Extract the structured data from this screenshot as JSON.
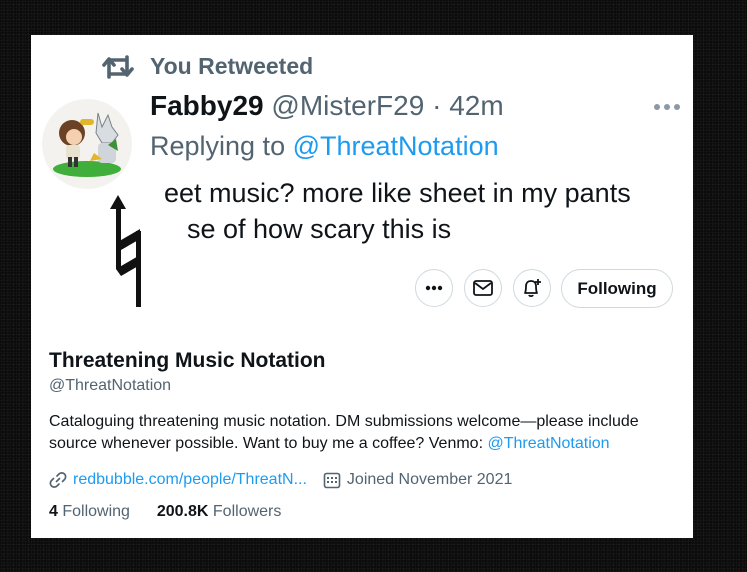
{
  "retweet": {
    "label": "You Retweeted",
    "icon": "retweet-icon"
  },
  "tweet": {
    "display_name": "Fabby29",
    "handle": "@MisterF29",
    "separator": "·",
    "time": "42m",
    "replying_prefix": "Replying to ",
    "replying_to": "@ThreatNotation",
    "text_line1": "eet music? more like sheet in my pants",
    "text_line2": "se of how scary this is"
  },
  "actions": {
    "more_icon": "more-horizontal-icon",
    "message_icon": "envelope-icon",
    "notify_icon": "bell-plus-icon",
    "follow_label": "Following"
  },
  "profile": {
    "name": "Threatening Music Notation",
    "handle": "@ThreatNotation",
    "bio_line1": "Cataloguing threatening music notation. DM submissions welcome—please include",
    "bio_line2_prefix": "source whenever possible. Want to buy me a coffee? Venmo: ",
    "bio_link": "@ThreatNotation",
    "website": "redbubble.com/people/ThreatN...",
    "joined": "Joined November 2021",
    "following_count": "4",
    "following_label": "Following",
    "followers_count": "200.8K",
    "followers_label": "Followers"
  },
  "colors": {
    "accent": "#1d9bf0",
    "text": "#0f1419",
    "muted": "#536471",
    "border": "#cfd9de",
    "background": "#0b0b0b"
  }
}
